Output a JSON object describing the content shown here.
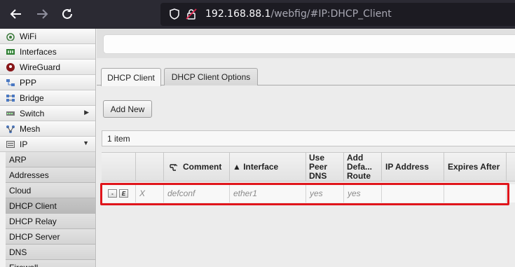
{
  "browser": {
    "url_host": "192.168.88.1",
    "url_path": "/webfig/#IP:DHCP_Client"
  },
  "sidebar": {
    "items": [
      {
        "label": "WiFi",
        "icon": "wifi-icon"
      },
      {
        "label": "Interfaces",
        "icon": "interfaces-icon"
      },
      {
        "label": "WireGuard",
        "icon": "wireguard-icon"
      },
      {
        "label": "PPP",
        "icon": "ppp-icon"
      },
      {
        "label": "Bridge",
        "icon": "bridge-icon"
      },
      {
        "label": "Switch",
        "icon": "switch-icon",
        "arrow": "▶"
      },
      {
        "label": "Mesh",
        "icon": "mesh-icon"
      },
      {
        "label": "IP",
        "icon": "ip-icon",
        "arrow": "▼"
      }
    ],
    "ip_submenu": [
      "ARP",
      "Addresses",
      "Cloud",
      "DHCP Client",
      "DHCP Relay",
      "DHCP Server",
      "DNS",
      "Firewall"
    ],
    "active_submenu": "DHCP Client"
  },
  "tabs": [
    {
      "label": "DHCP Client",
      "active": true
    },
    {
      "label": "DHCP Client Options",
      "active": false
    }
  ],
  "toolbar": {
    "add_new_label": "Add New"
  },
  "list": {
    "count_text": "1 item"
  },
  "table": {
    "columns": {
      "comment": "Comment",
      "interface": "▲ Interface",
      "use_peer_dns": "Use Peer DNS",
      "add_default_route": "Add Defa... Route",
      "ip_address": "IP Address",
      "expires_after": "Expires After"
    },
    "rows": [
      {
        "remove_btn": "-",
        "enable_btn": "E",
        "flag": "X",
        "comment": "defconf",
        "interface": "ether1",
        "use_peer_dns": "yes",
        "add_default_route": "yes",
        "ip_address": "",
        "expires_after": ""
      }
    ]
  },
  "colors": {
    "highlight": "#e0151b",
    "browser_bar": "#2b2a33"
  }
}
